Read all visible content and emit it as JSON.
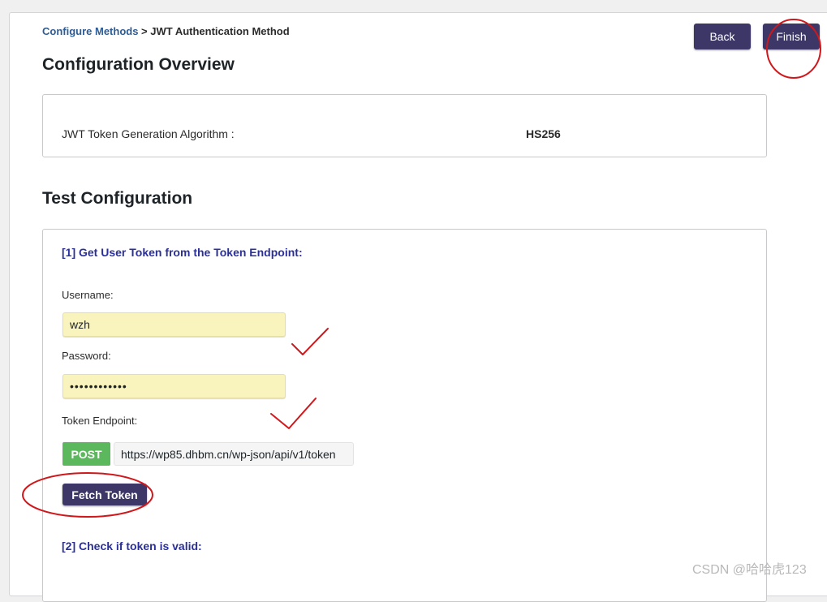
{
  "breadcrumb": {
    "parent": "Configure Methods",
    "separator": " > ",
    "current": "JWT Authentication Method"
  },
  "actions": {
    "back_label": "Back",
    "finish_label": "Finish"
  },
  "overview": {
    "heading": "Configuration Overview",
    "algorithm_label": "JWT Token Generation Algorithm :",
    "algorithm_value": "HS256"
  },
  "test": {
    "heading": "Test Configuration",
    "step1_title": "[1] Get User Token from the Token Endpoint:",
    "username_label": "Username:",
    "username_value": "wzh",
    "password_label": "Password:",
    "password_value": "••••••••••••",
    "endpoint_label": "Token Endpoint:",
    "method_badge": "POST",
    "endpoint_value": "https://wp85.dhbm.cn/wp-json/api/v1/token",
    "fetch_label": "Fetch Token",
    "step2_title": "[2] Check if token is valid:"
  },
  "watermark": "CSDN @哈哈虎123",
  "colors": {
    "primary_button": "#3c3766",
    "post_badge": "#5cb85c",
    "step_title": "#2a2f9a",
    "link": "#2d5c95",
    "autofill_bg": "#f9f3bd",
    "annotation": "#d0181c"
  }
}
